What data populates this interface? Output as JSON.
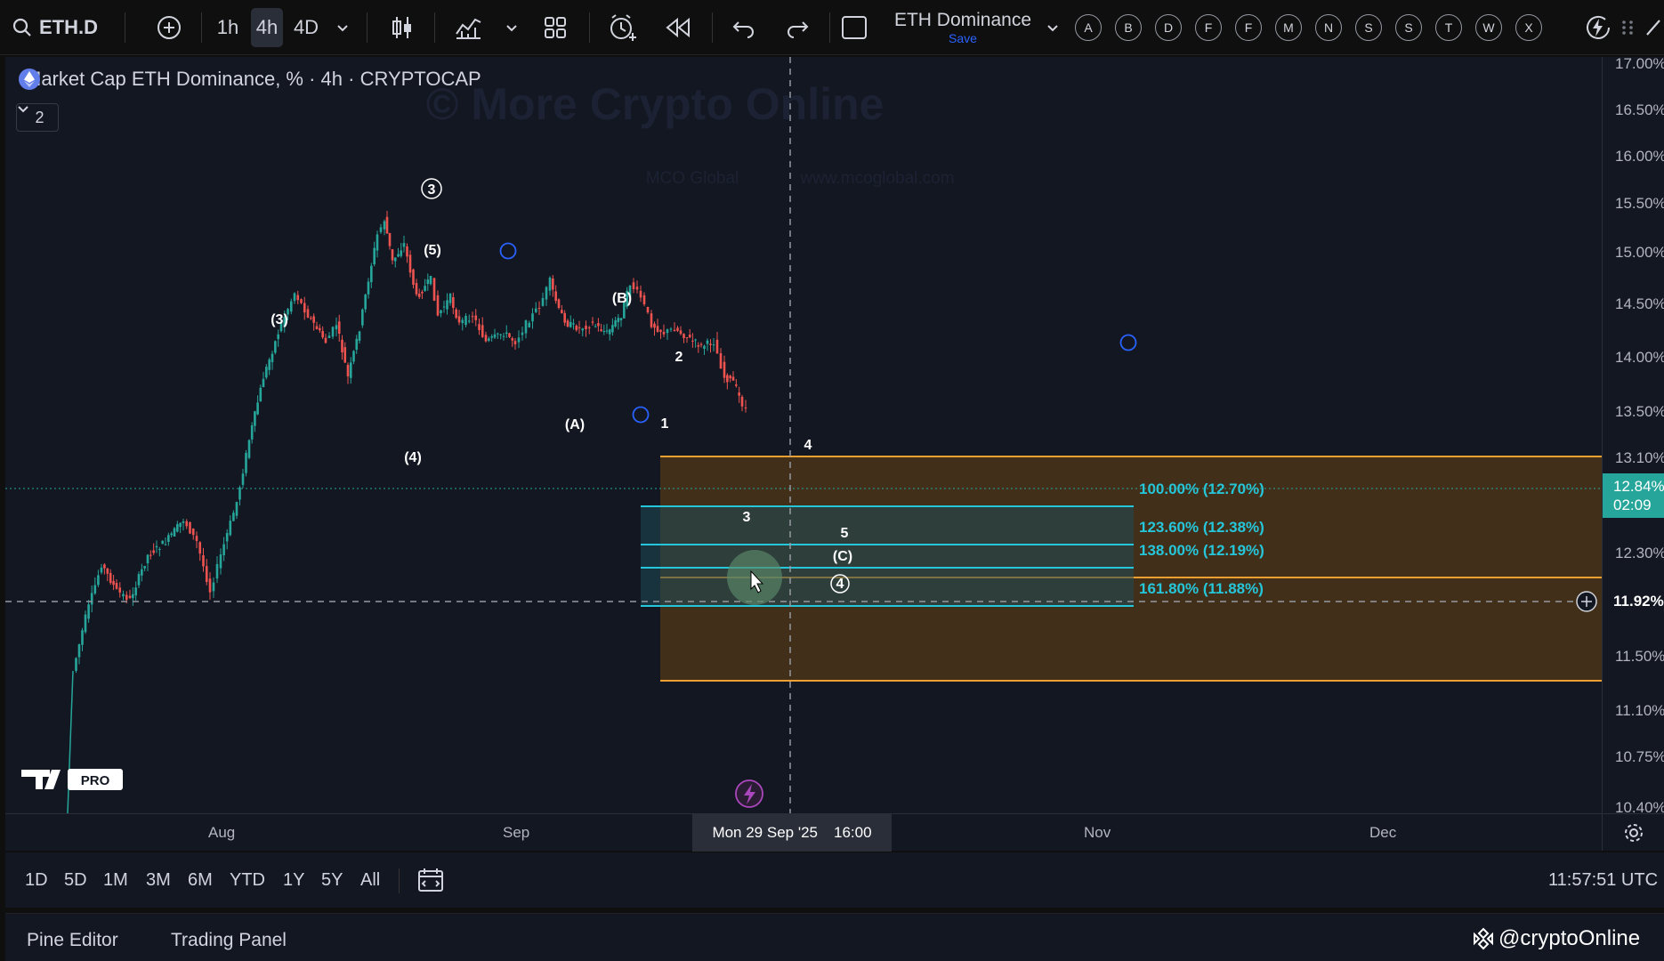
{
  "toolbar": {
    "symbol": "ETH.D",
    "intervals": [
      "1h",
      "4h",
      "4D"
    ],
    "active_interval": "4h",
    "layout_name": "ETH Dominance",
    "save_label": "Save",
    "alphabet_buttons": [
      "A",
      "B",
      "D",
      "F",
      "F",
      "M",
      "N",
      "S",
      "S",
      "T",
      "W",
      "X"
    ]
  },
  "legend": {
    "title": "Market Cap ETH Dominance, % · 4h · CRYPTOCAP",
    "collapse_count": "2"
  },
  "watermark": {
    "main": "© More Crypto Online",
    "left": "MCO Global",
    "right": "www.mcoglobal.com"
  },
  "price_axis": {
    "ticks": [
      "17.00%",
      "16.50%",
      "16.00%",
      "15.50%",
      "15.00%",
      "14.50%",
      "14.00%",
      "13.50%",
      "13.10%",
      "12.30%",
      "11.50%",
      "11.10%",
      "10.75%",
      "10.40%"
    ],
    "current_price": "12.84%",
    "countdown": "02:09",
    "crosshair_price": "11.92%"
  },
  "time_axis": {
    "ticks": [
      "Aug",
      "Sep",
      "Nov",
      "Dec"
    ],
    "crosshair_label": "Mon 29 Sep '25",
    "crosshair_time": "16:00"
  },
  "waves": {
    "c3": "3",
    "c4": "4",
    "w5": "(5)",
    "w3": "(3)",
    "w4": "(4)",
    "wA": "(A)",
    "wB": "(B)",
    "wC": "(C)",
    "n1": "1",
    "n2": "2",
    "n3": "3",
    "n4": "4",
    "n5": "5"
  },
  "fib_levels": [
    {
      "label": "100.00% (12.70%)"
    },
    {
      "label": "123.60% (12.38%)"
    },
    {
      "label": "138.00% (12.19%)"
    },
    {
      "label": "161.80% (11.88%)"
    }
  ],
  "logo": {
    "badge": "PRO"
  },
  "range_bar": {
    "ranges": [
      "1D",
      "5D",
      "1M",
      "3M",
      "6M",
      "YTD",
      "1Y",
      "5Y",
      "All"
    ],
    "clock": "11:57:51 UTC"
  },
  "bottom_panel": {
    "tabs": [
      "Pine Editor",
      "Trading Panel"
    ],
    "handle": "@cryptoOnline"
  },
  "colors": {
    "background": "#131722",
    "up": "#26a69a",
    "down": "#ef5350",
    "zone": "#4a3418",
    "zone_line": "#f0a030",
    "fib": "#26c6da"
  }
}
